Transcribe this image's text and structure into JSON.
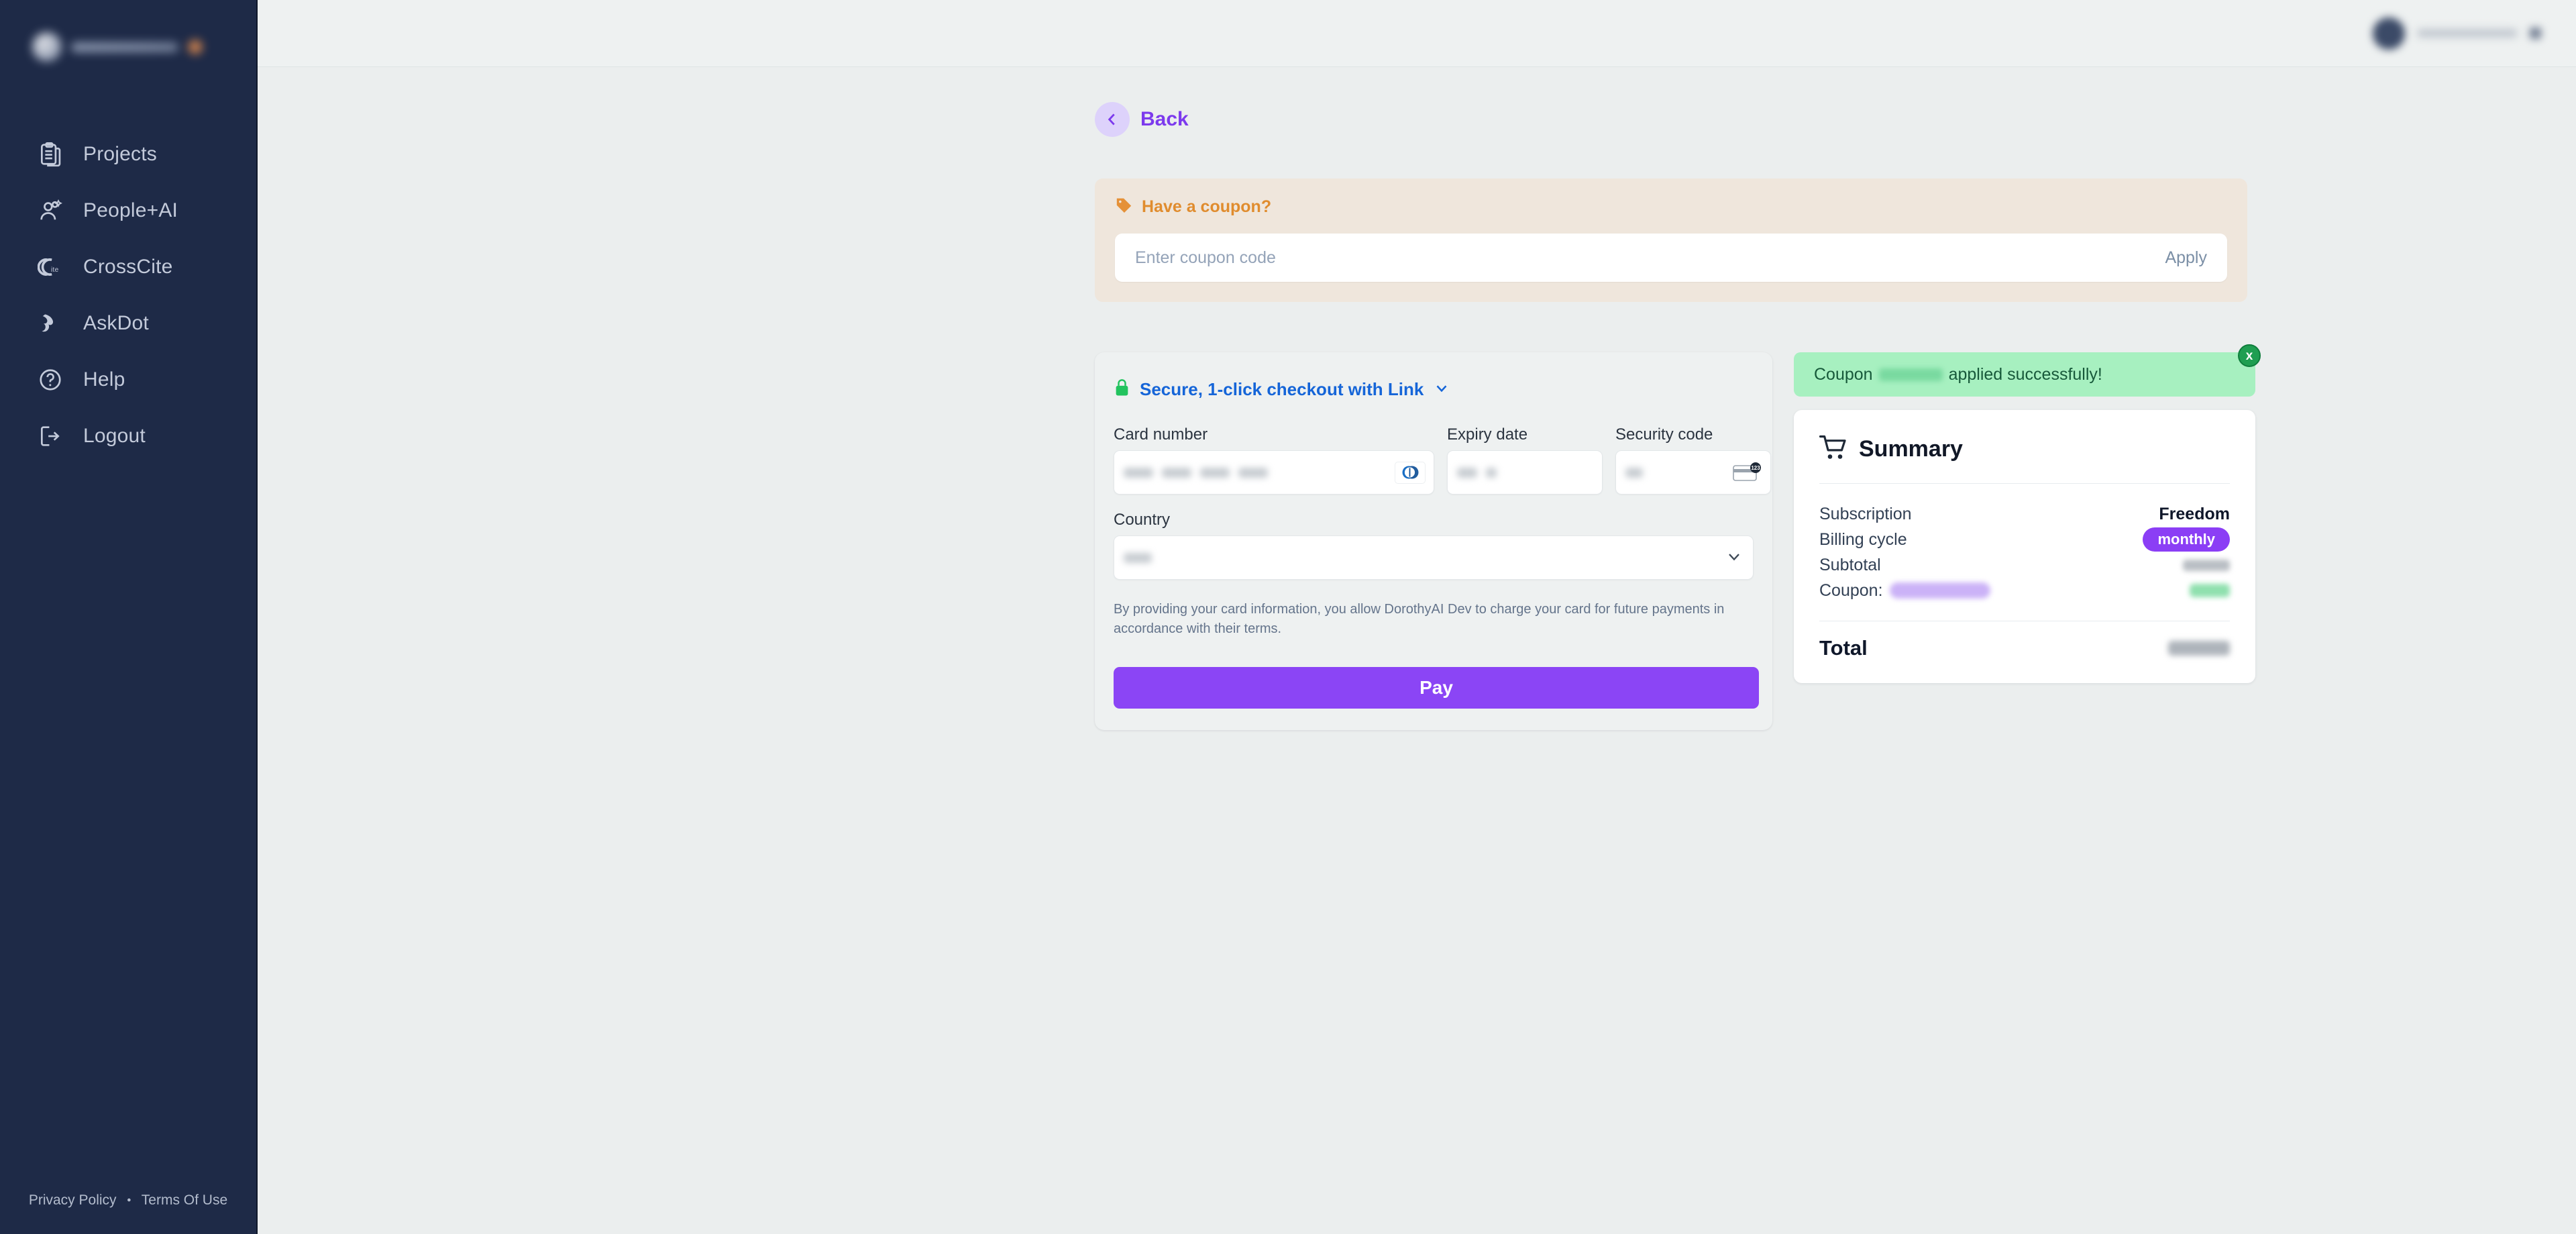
{
  "sidebar": {
    "logo": {
      "name": "app-logo",
      "redacted": true
    },
    "items": [
      {
        "label": "Projects",
        "icon": "clipboard-icon"
      },
      {
        "label": "People+AI",
        "icon": "people-ai-icon"
      },
      {
        "label": "CrossCite",
        "icon": "crosscite-icon"
      },
      {
        "label": "AskDot",
        "icon": "askdot-icon"
      },
      {
        "label": "Help",
        "icon": "question-circle-icon"
      },
      {
        "label": "Logout",
        "icon": "logout-icon"
      }
    ],
    "footer": {
      "privacy_label": "Privacy Policy",
      "separator": "•",
      "terms_label": "Terms Of Use"
    }
  },
  "topbar": {
    "user": {
      "name_redacted": true,
      "caret_icon": "chevron-down-icon"
    }
  },
  "back": {
    "label": "Back",
    "icon": "chevron-left-icon"
  },
  "coupon_banner": {
    "icon": "tag-icon",
    "title": "Have a coupon?",
    "placeholder": "Enter coupon code",
    "value": "",
    "apply_label": "Apply"
  },
  "payment": {
    "link_header": {
      "lock_icon": "lock-icon",
      "label": "Secure, 1-click checkout with Link",
      "chevron_icon": "chevron-down-icon"
    },
    "fields": {
      "card_number_label": "Card number",
      "card_number_value_redacted": true,
      "card_brand_icon": "diners-club-card-icon",
      "expiry_label": "Expiry date",
      "expiry_value_redacted": true,
      "security_label": "Security code",
      "security_value_redacted": true,
      "cvc_hint_icon": "card-cvc-icon",
      "country_label": "Country",
      "country_value_redacted": true,
      "country_chevron_icon": "chevron-down-icon"
    },
    "disclaimer": "By providing your card information, you allow DorothyAI Dev to charge your card for future payments in accordance with their terms.",
    "pay_label": "Pay"
  },
  "success_banner": {
    "prefix": "Coupon",
    "code_redacted": true,
    "suffix": "applied successfully!",
    "close_label": "x",
    "close_icon": "close-icon"
  },
  "summary": {
    "cart_icon": "shopping-cart-icon",
    "title": "Summary",
    "rows": [
      {
        "label": "Subscription",
        "value": "Freedom",
        "type": "strong"
      },
      {
        "label": "Billing cycle",
        "value": "monthly",
        "type": "badge"
      },
      {
        "label": "Subtotal",
        "value": "",
        "type": "redacted-gray"
      },
      {
        "label": "Coupon:",
        "value": "",
        "type": "redacted-coupon"
      }
    ],
    "total_label": "Total",
    "total_value_redacted": true
  },
  "colors": {
    "sidebar_bg": "#1e2a47",
    "page_bg": "#ebeeee",
    "accent_purple": "#8b45f5",
    "back_purple": "#7c3aed",
    "coupon_banner_bg": "#efe6dc",
    "coupon_orange": "#e08c2e",
    "link_blue": "#1565d8",
    "lock_green": "#22c35e",
    "success_green_bg": "#a7f0c0",
    "success_close_green": "#1f9e51",
    "badge_purple": "#8b3ef5"
  }
}
